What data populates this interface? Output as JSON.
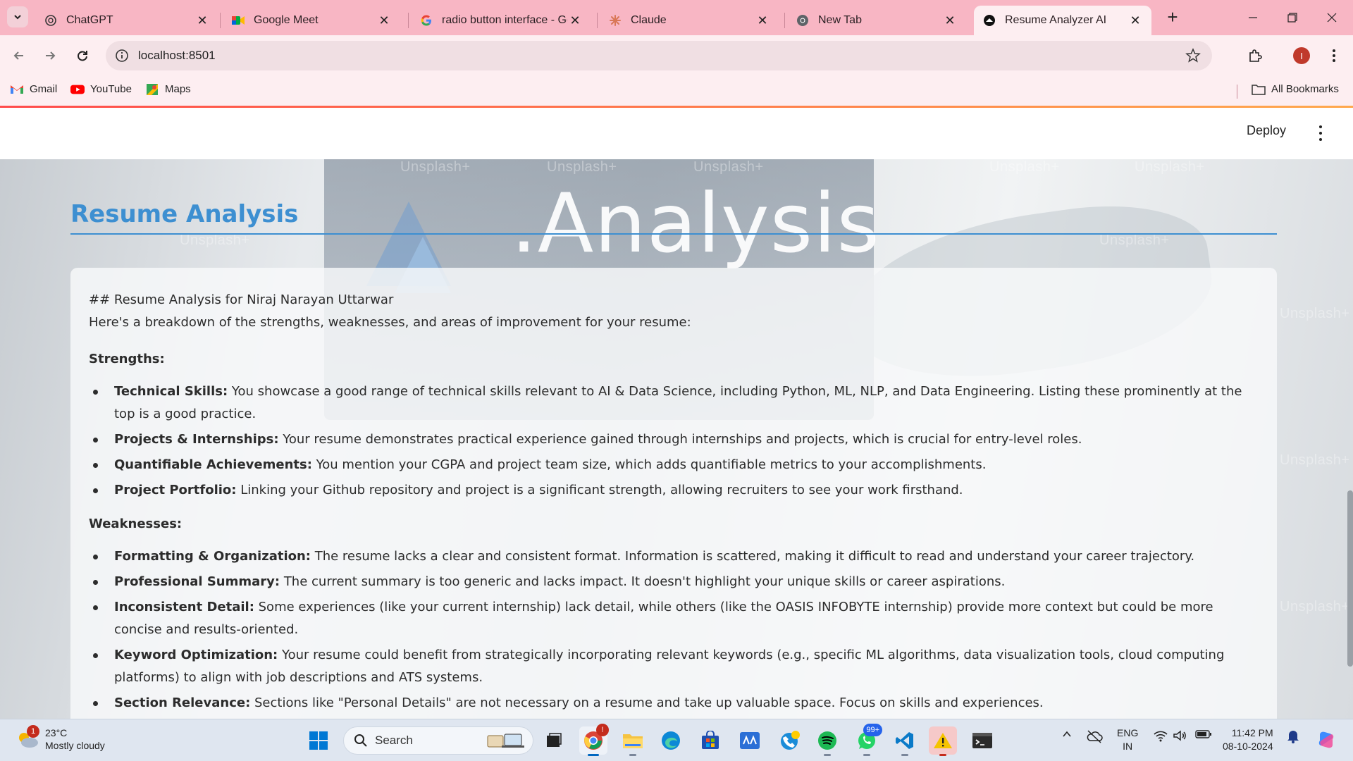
{
  "browser": {
    "tabs": [
      {
        "title": "ChatGPT",
        "icon": "chatgpt-icon",
        "active": false
      },
      {
        "title": "Google Meet",
        "icon": "google-meet-icon",
        "active": false
      },
      {
        "title": "radio button interface - Go",
        "icon": "google-icon",
        "active": false
      },
      {
        "title": "Claude",
        "icon": "claude-icon",
        "active": false
      },
      {
        "title": "New Tab",
        "icon": "chrome-icon",
        "active": false
      },
      {
        "title": "Resume Analyzer AI",
        "icon": "streamlit-icon",
        "active": true
      }
    ],
    "url": "localhost:8501",
    "profile_initial": "I",
    "bookmarks": [
      {
        "label": "Gmail",
        "icon": "gmail-icon"
      },
      {
        "label": "YouTube",
        "icon": "youtube-icon"
      },
      {
        "label": "Maps",
        "icon": "maps-icon"
      }
    ],
    "all_bookmarks_label": "All Bookmarks",
    "accent_color": "#f8b6c4"
  },
  "app": {
    "deploy_label": "Deploy",
    "page_title": "Resume Analysis",
    "background_word": ".Analysis",
    "watermark_text": "Unsplash+",
    "title_color": "#3d8fd1",
    "analysis": {
      "heading_line": "## Resume Analysis for Niraj Narayan Uttarwar",
      "intro": "Here's a breakdown of the strengths, weaknesses, and areas of improvement for your resume:",
      "strengths_heading": "Strengths:",
      "strengths": [
        {
          "title": "Technical Skills:",
          "text": " You showcase a good range of technical skills relevant to AI & Data Science, including Python, ML, NLP, and Data Engineering. Listing these prominently at the top is a good practice."
        },
        {
          "title": "Projects & Internships:",
          "text": " Your resume demonstrates practical experience gained through internships and projects, which is crucial for entry-level roles."
        },
        {
          "title": "Quantifiable Achievements:",
          "text": " You mention your CGPA and project team size, which adds quantifiable metrics to your accomplishments."
        },
        {
          "title": "Project Portfolio:",
          "text": " Linking your Github repository and project is a significant strength, allowing recruiters to see your work firsthand."
        }
      ],
      "weaknesses_heading": "Weaknesses:",
      "weaknesses": [
        {
          "title": "Formatting & Organization:",
          "text": " The resume lacks a clear and consistent format. Information is scattered, making it difficult to read and understand your career trajectory."
        },
        {
          "title": "Professional Summary:",
          "text": " The current summary is too generic and lacks impact. It doesn't highlight your unique skills or career aspirations."
        },
        {
          "title": "Inconsistent Detail:",
          "text": " Some experiences (like your current internship) lack detail, while others (like the OASIS INFOBYTE internship) provide more context but could be more concise and results-oriented."
        },
        {
          "title": "Keyword Optimization:",
          "text": " Your resume could benefit from strategically incorporating relevant keywords (e.g., specific ML algorithms, data visualization tools, cloud computing platforms) to align with job descriptions and ATS systems."
        },
        {
          "title": "Section Relevance:",
          "text": " Sections like \"Personal Details\" are not necessary on a resume and take up valuable space. Focus on skills and experiences."
        }
      ]
    }
  },
  "taskbar": {
    "weather": {
      "temp": "23°C",
      "condition": "Mostly cloudy",
      "badge": "1"
    },
    "search_label": "Search",
    "whatsapp_badge": "99+",
    "chrome_badge": "!",
    "language": {
      "line1": "ENG",
      "line2": "IN"
    },
    "time": "11:42 PM",
    "date": "08-10-2024"
  }
}
